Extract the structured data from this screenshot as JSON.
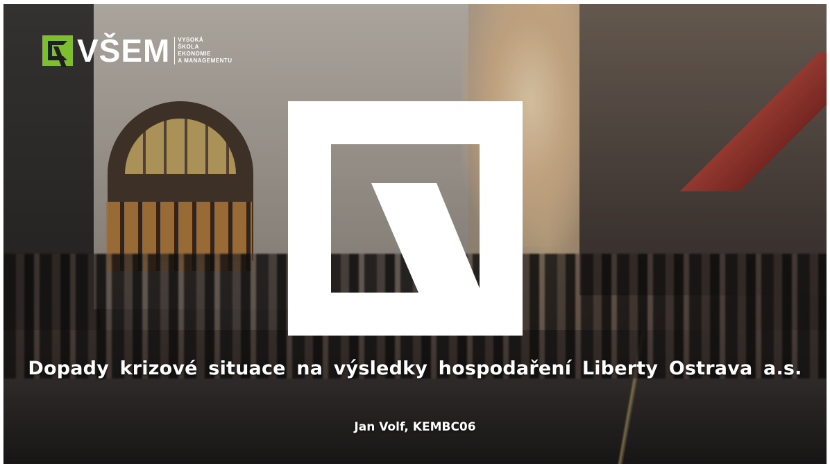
{
  "slide": {
    "logo": {
      "wordmark": "VŠEM",
      "subtitle_lines": [
        "VYSOKÁ",
        "ŠKOLA",
        "EKONOMIE",
        "A MANAGEMENTU"
      ],
      "accent_color": "#7dbf2e"
    },
    "emblem_icon": "vsem-emblem-icon",
    "title": "Dopady krizové situace na výsledky hospodaření Liberty Ostrava a.s.",
    "author": "Jan Volf, KEMBC06"
  }
}
